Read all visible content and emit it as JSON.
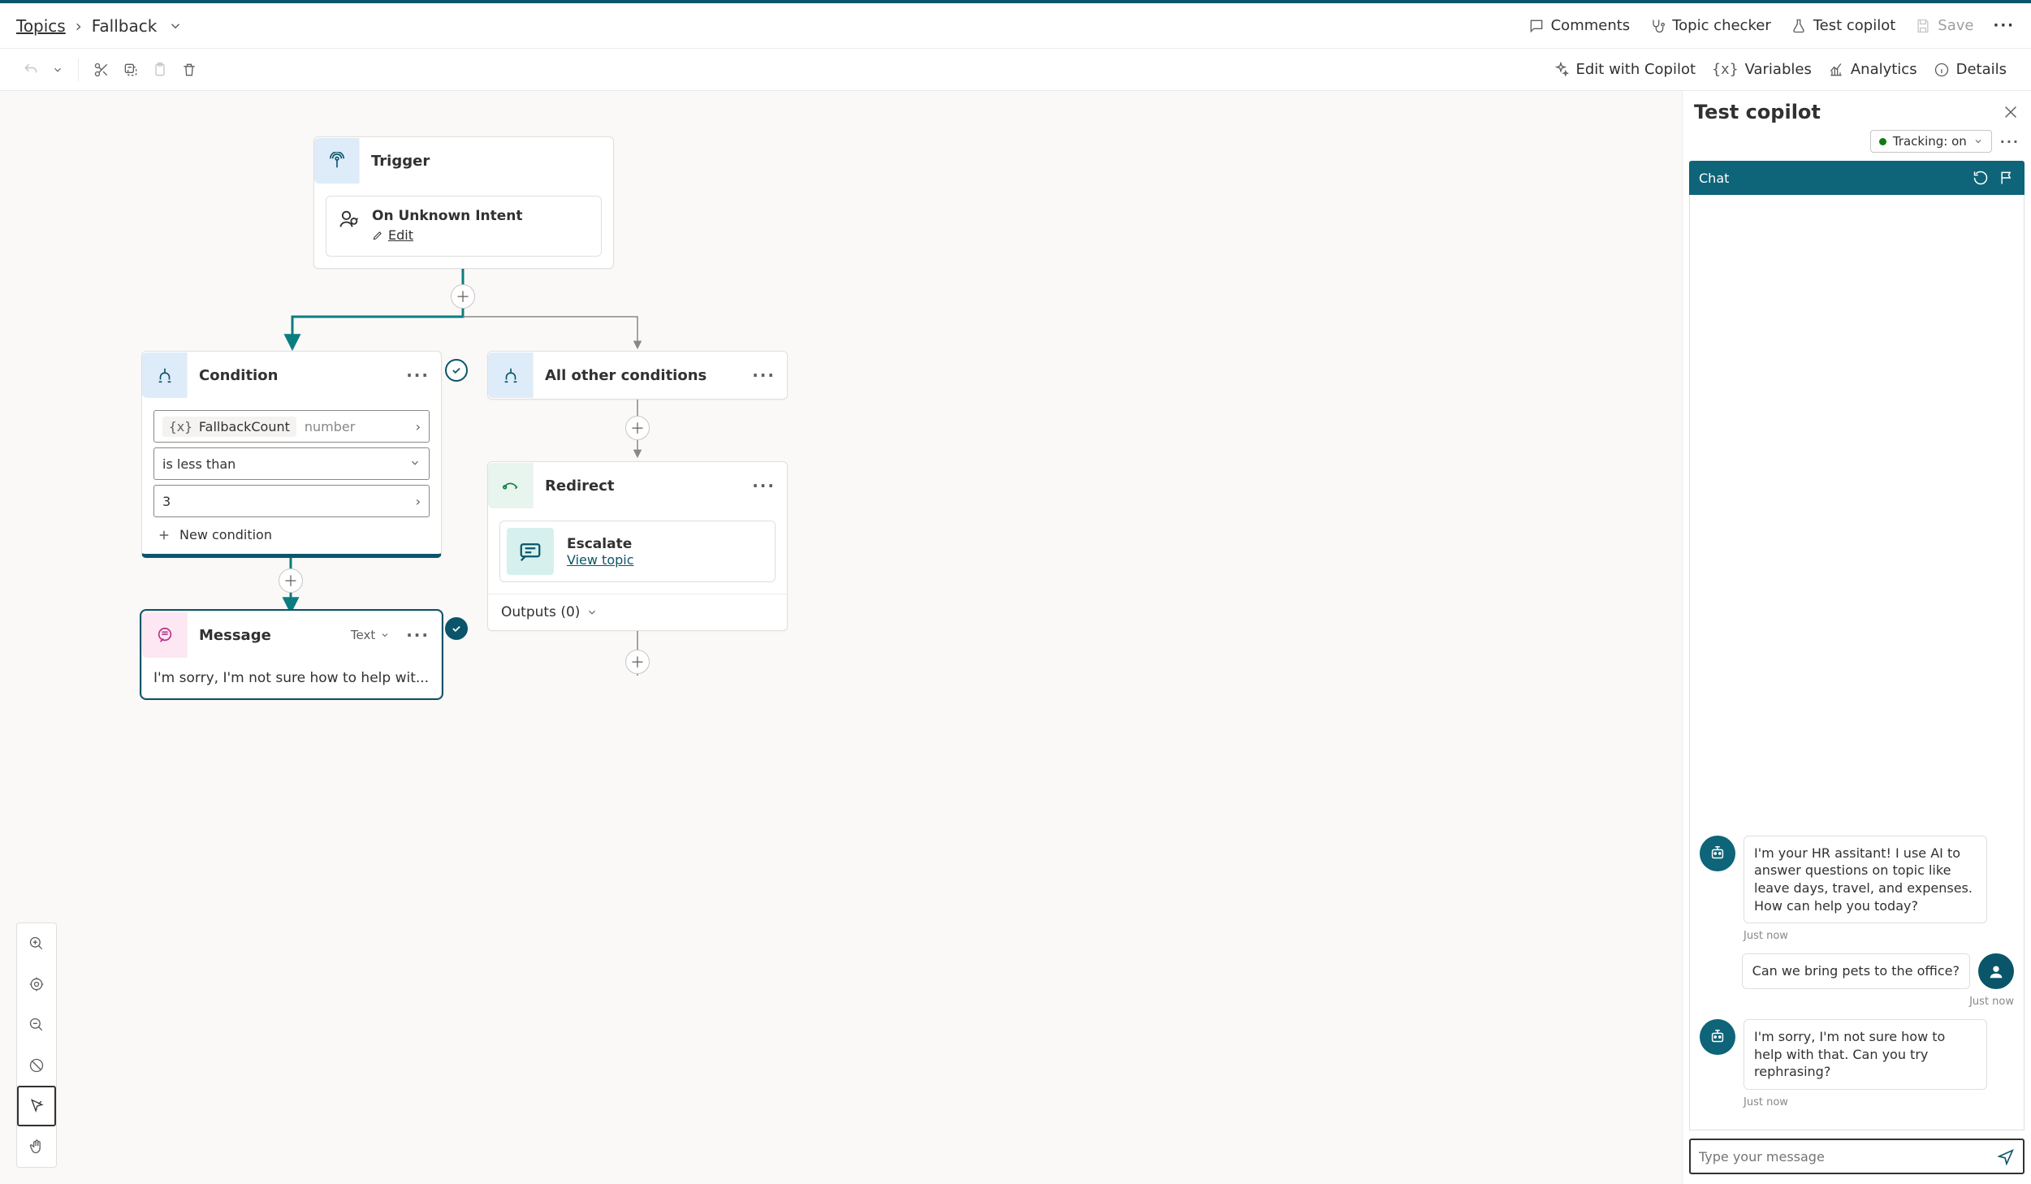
{
  "breadcrumb": {
    "root": "Topics",
    "current": "Fallback"
  },
  "top_actions": {
    "comments": "Comments",
    "topic_checker": "Topic checker",
    "test_copilot": "Test copilot",
    "save": "Save"
  },
  "toolbar": {
    "edit_copilot": "Edit with Copilot",
    "variables": "Variables",
    "analytics": "Analytics",
    "details": "Details"
  },
  "trigger": {
    "title": "Trigger",
    "sub_title": "On Unknown Intent",
    "edit": "Edit"
  },
  "condition": {
    "title": "Condition",
    "variable": "FallbackCount",
    "var_type": "number",
    "operator": "is less than",
    "value": "3",
    "new_cond": "New condition"
  },
  "all_other": {
    "title": "All other conditions"
  },
  "redirect": {
    "title": "Redirect",
    "target": "Escalate",
    "view_topic": "View topic",
    "outputs": "Outputs (0)"
  },
  "message_node": {
    "title": "Message",
    "type_label": "Text",
    "preview": "I'm sorry, I'm not sure how to help wit..."
  },
  "panel": {
    "title": "Test copilot",
    "tracking": "Tracking: on",
    "chat_label": "Chat",
    "input_placeholder": "Type your message",
    "msgs": {
      "bot1": "I'm your HR assitant! I use AI to answer questions on topic like leave days, travel, and expenses. How can help you today?",
      "ts1": "Just now",
      "user1": "Can we bring pets to the office?",
      "ts2": "Just now",
      "bot2": "I'm sorry, I'm not sure how to help with that. Can you try rephrasing?",
      "ts3": "Just now"
    }
  }
}
